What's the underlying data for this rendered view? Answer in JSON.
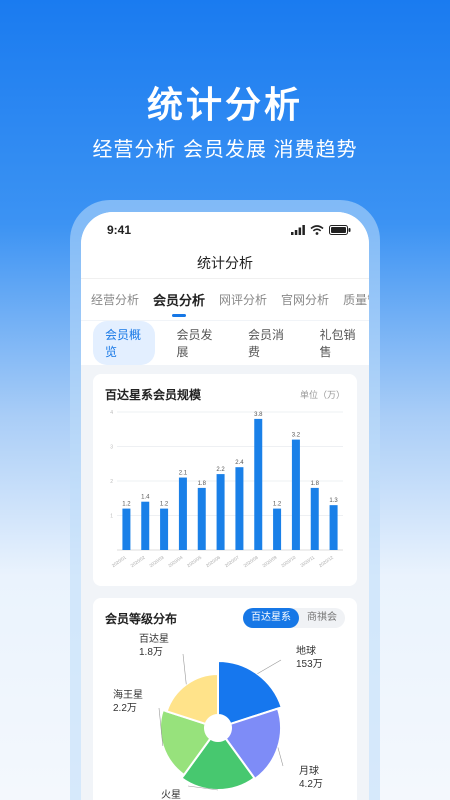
{
  "hero": {
    "title": "统计分析",
    "subtitle": "经营分析 会员发展 消费趋势"
  },
  "status": {
    "time": "9:41"
  },
  "nav": {
    "title": "统计分析"
  },
  "tabs": [
    {
      "label": "经营分析",
      "active": false
    },
    {
      "label": "会员分析",
      "active": true
    },
    {
      "label": "网评分析",
      "active": false
    },
    {
      "label": "官网分析",
      "active": false
    },
    {
      "label": "质量管理",
      "active": false
    }
  ],
  "subtabs": [
    {
      "label": "会员概览",
      "active": true
    },
    {
      "label": "会员发展",
      "active": false
    },
    {
      "label": "会员消费",
      "active": false
    },
    {
      "label": "礼包销售",
      "active": false
    }
  ],
  "bar_card": {
    "title": "百达星系会员规模",
    "unit": "单位（万）"
  },
  "pie_card": {
    "title": "会员等级分布",
    "toggle": [
      {
        "label": "百达星系",
        "active": true
      },
      {
        "label": "商祺会",
        "active": false
      }
    ]
  },
  "colors": {
    "accent": "#1677e6",
    "bar": "#1a80e8",
    "pie": [
      "#1677ee",
      "#7e8cf7",
      "#47c86f",
      "#97e27c",
      "#ffe38a"
    ]
  },
  "chart_data": [
    {
      "type": "bar",
      "categories": [
        "2020/01",
        "2020/02",
        "2020/03",
        "2020/04",
        "2020/05",
        "2020/06",
        "2020/07",
        "2020/08",
        "2020/09",
        "2020/10",
        "2020/11",
        "2020/12"
      ],
      "values": [
        1.2,
        1.4,
        1.2,
        2.1,
        1.8,
        2.2,
        2.4,
        3.8,
        1.2,
        3.2,
        1.8,
        1.3
      ],
      "title": "百达星系会员规模",
      "ylabel": "单位（万）",
      "yticks": [
        1,
        2,
        3,
        4
      ],
      "ylim": [
        0,
        4
      ],
      "grid": true
    },
    {
      "type": "pie",
      "style": "donut-rose",
      "title": "会员等级分布",
      "slices": [
        {
          "name": "地球",
          "value_label": "153万"
        },
        {
          "name": "月球",
          "value_label": "4.2万"
        },
        {
          "name": "火星",
          "value_label": ""
        },
        {
          "name": "海王星",
          "value_label": "2.2万"
        },
        {
          "name": "百达星",
          "value_label": "1.8万"
        }
      ]
    }
  ]
}
